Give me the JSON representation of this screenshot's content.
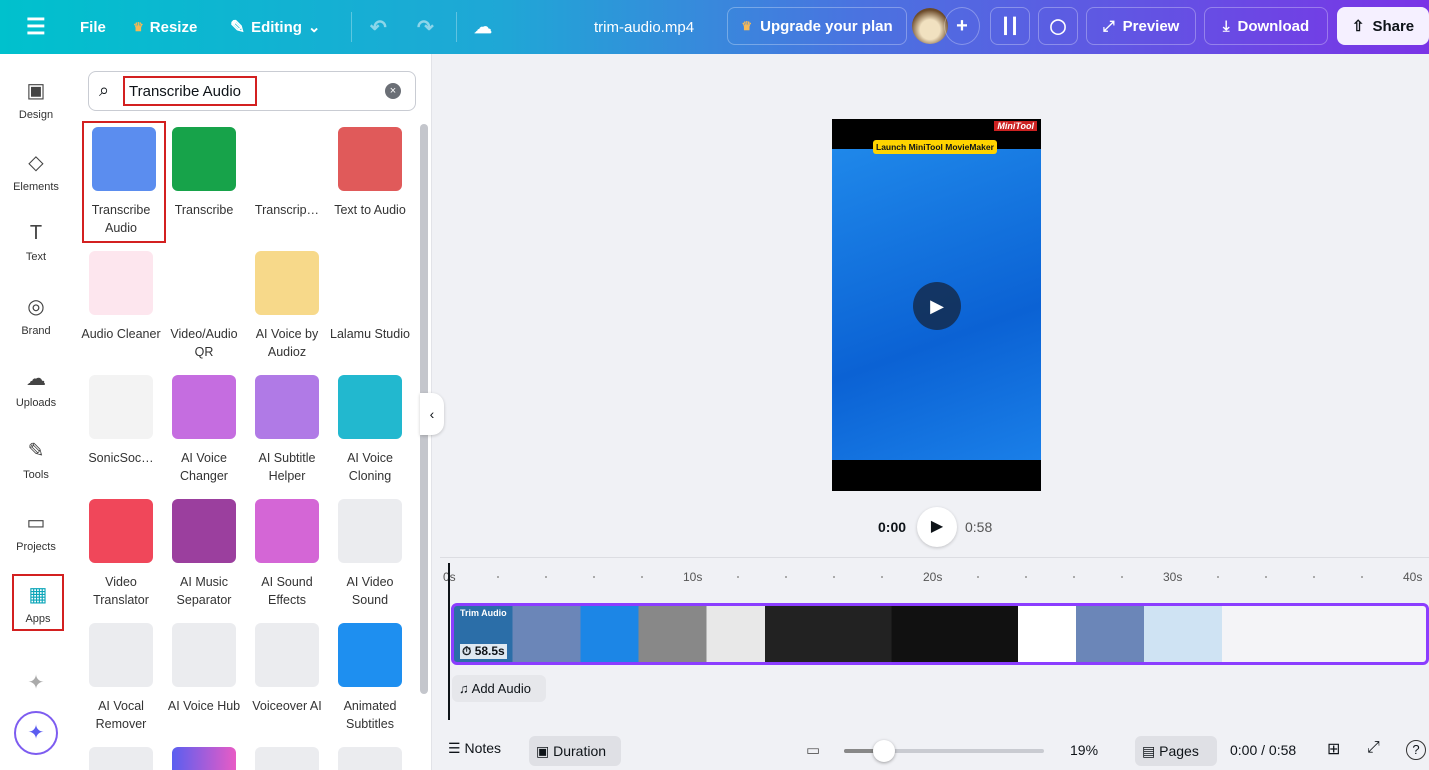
{
  "topbar": {
    "file": "File",
    "resize": "Resize",
    "editing": "Editing",
    "filename": "trim-audio.mp4",
    "upgrade": "Upgrade your plan",
    "preview": "Preview",
    "download": "Download",
    "share": "Share"
  },
  "rail": [
    {
      "label": "Design",
      "icon": "▣"
    },
    {
      "label": "Elements",
      "icon": "◇"
    },
    {
      "label": "Text",
      "icon": "T"
    },
    {
      "label": "Brand",
      "icon": "◎"
    },
    {
      "label": "Uploads",
      "icon": "☁"
    },
    {
      "label": "Tools",
      "icon": "✎"
    },
    {
      "label": "Projects",
      "icon": "▭"
    },
    {
      "label": "Apps",
      "icon": "▦"
    }
  ],
  "search": {
    "value": "Transcribe Audio"
  },
  "apps": [
    {
      "label": "Transcribe Audio",
      "color": "#5b8def"
    },
    {
      "label": "Transcribe",
      "color": "#17a34a"
    },
    {
      "label": "Transcrip…",
      "color": "#ffffff"
    },
    {
      "label": "Text to Audio",
      "color": "#e05a5a"
    },
    {
      "label": "Audio Cleaner",
      "color": "#fde6ee"
    },
    {
      "label": "Video/Audio QR",
      "color": "#ffffff"
    },
    {
      "label": "AI Voice by Audioz",
      "color": "#f7d98a"
    },
    {
      "label": "Lalamu Studio",
      "color": "#ffffff"
    },
    {
      "label": "SonicSoc…",
      "color": "#f3f3f3"
    },
    {
      "label": "AI Voice Changer",
      "color": "#c56de0"
    },
    {
      "label": "AI Subtitle Helper",
      "color": "#b07ae6"
    },
    {
      "label": "AI Voice Cloning",
      "color": "#22b8cf"
    },
    {
      "label": "Video Translator",
      "color": "#f0475a"
    },
    {
      "label": "AI Music Separator",
      "color": "#9b3f9e"
    },
    {
      "label": "AI Sound Effects",
      "color": "#d466d6"
    },
    {
      "label": "AI Video Sound",
      "color": "#ebecef"
    },
    {
      "label": "AI Vocal Remover",
      "color": "#ebecef"
    },
    {
      "label": "AI Voice Hub",
      "color": "#ebecef"
    },
    {
      "label": "Voiceover AI",
      "color": "#ebecef"
    },
    {
      "label": "Animated Subtitles",
      "color": "#1e8ff0"
    }
  ],
  "preview": {
    "badge": "Launch MiniTool MovieMaker",
    "brand": "MiniTool",
    "current": "0:00",
    "total": "0:58"
  },
  "timeline": {
    "ticks": [
      "0s",
      "10s",
      "20s",
      "30s",
      "40s"
    ],
    "clip_title": "Trim Audio",
    "clip_duration": "58.5s",
    "add_audio": "Add Audio"
  },
  "bottom": {
    "notes": "Notes",
    "duration": "Duration",
    "zoom": "19%",
    "zoom_fraction": 0.2,
    "pages": "Pages",
    "time": "0:00 / 0:58"
  }
}
